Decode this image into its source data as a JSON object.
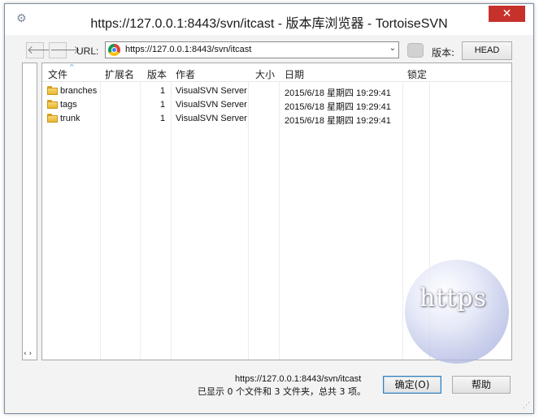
{
  "window": {
    "title": "https://127.0.0.1:8443/svn/itcast - 版本库浏览器 - TortoiseSVN",
    "close_glyph": "✕"
  },
  "toolbar": {
    "back_glyph": "🡐",
    "forward_glyph": "🡒",
    "url_label": "URL:",
    "url_value": "https://127.0.0.1:8443/svn/itcast",
    "url_dropdown_glyph": "⌄",
    "revision_label": "版本:",
    "revision_button": "HEAD"
  },
  "left_pane": {
    "split_glyph": "‹ ›"
  },
  "columns": [
    "文件",
    "扩展名",
    "版本",
    "作者",
    "大小",
    "日期",
    "锁定"
  ],
  "sort_glyph": "^",
  "rows": [
    {
      "name": "branches",
      "ext": "",
      "rev": "1",
      "author": "VisualSVN Server",
      "size": "",
      "date": "2015/6/18 星期四 19:29:41",
      "lock": ""
    },
    {
      "name": "tags",
      "ext": "",
      "rev": "1",
      "author": "VisualSVN Server",
      "size": "",
      "date": "2015/6/18 星期四 19:29:41",
      "lock": ""
    },
    {
      "name": "trunk",
      "ext": "",
      "rev": "1",
      "author": "VisualSVN Server",
      "size": "",
      "date": "2015/6/18 星期四 19:29:41",
      "lock": ""
    }
  ],
  "watermark": {
    "text": "https"
  },
  "status": {
    "url": "https://127.0.0.1:8443/svn/itcast",
    "summary": "已显示 0 个文件和 3 文件夹，总共 3 项。"
  },
  "buttons": {
    "ok": "确定(O)",
    "help": "帮助"
  },
  "colors": {
    "close": "#c7312b",
    "folder": "#f0c24a",
    "border": "#a8a8a8"
  },
  "icons": [
    "app-icon",
    "back-arrow-icon",
    "forward-arrow-icon",
    "chrome-icon",
    "bubble-icon",
    "folder-icon",
    "https-globe-icon"
  ]
}
